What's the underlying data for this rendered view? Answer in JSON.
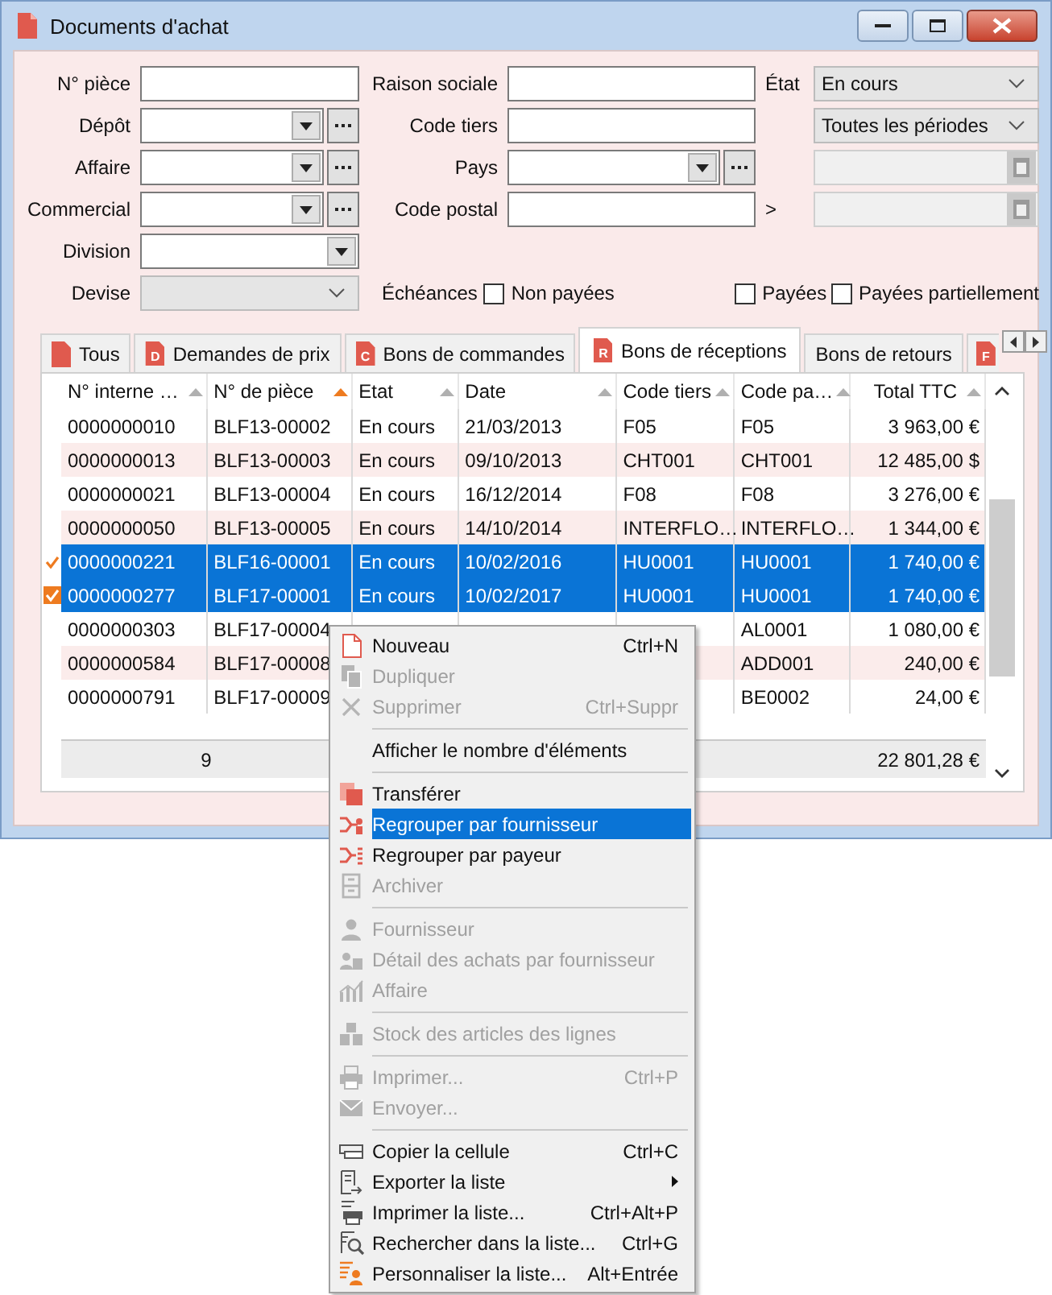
{
  "window": {
    "title": "Documents d'achat"
  },
  "left_fields": [
    {
      "label": "N° pièce",
      "kind": "text"
    },
    {
      "label": "Dépôt",
      "kind": "combo"
    },
    {
      "label": "Affaire",
      "kind": "combo"
    },
    {
      "label": "Commercial",
      "kind": "combo"
    },
    {
      "label": "Division",
      "kind": "dropdown"
    },
    {
      "label": "Devise",
      "kind": "select",
      "disabled": true
    }
  ],
  "middle_fields": [
    {
      "label": "Raison sociale",
      "kind": "text"
    },
    {
      "label": "Code tiers",
      "kind": "text"
    },
    {
      "label": "Pays",
      "kind": "combo"
    },
    {
      "label": "Code postal",
      "kind": "text"
    }
  ],
  "etat": {
    "label": "État",
    "value": "En cours"
  },
  "period": {
    "value": "Toutes les périodes"
  },
  "date_from": {
    "disabled": true
  },
  "date_to": {
    "label": ">",
    "disabled": true
  },
  "echeances": {
    "label": "Échéances",
    "options": [
      {
        "label": "Non payées",
        "checked": false
      },
      {
        "label": "Payées",
        "checked": false
      },
      {
        "label": "Payées partiellement",
        "checked": false
      }
    ]
  },
  "tabs": [
    {
      "label": "Tous",
      "selected": false
    },
    {
      "label": "Demandes de prix",
      "badge": "D",
      "selected": false
    },
    {
      "label": "Bons de commandes",
      "badge": "C",
      "selected": false
    },
    {
      "label": "Bons de réceptions",
      "badge": "R",
      "selected": true
    },
    {
      "label": "Bons de retours",
      "selected": false
    },
    {
      "badge": "F",
      "selected": false
    }
  ],
  "table": {
    "columns": [
      {
        "label": "N° interne …",
        "sorted": false
      },
      {
        "label": "N° de pièce",
        "sorted": true
      },
      {
        "label": "Etat",
        "sorted": false
      },
      {
        "label": "Date",
        "sorted": false
      },
      {
        "label": "Code tiers",
        "sorted": false
      },
      {
        "label": "Code pa…",
        "sorted": false
      },
      {
        "label": "Total TTC",
        "sorted": false
      }
    ],
    "rows": [
      {
        "cells": [
          "0000000010",
          "BLF13-00002",
          "En cours",
          "21/03/2013",
          "F05",
          "F05",
          "3 963,00 €"
        ],
        "selected": false,
        "current": false,
        "checked": false
      },
      {
        "cells": [
          "0000000013",
          "BLF13-00003",
          "En cours",
          "09/10/2013",
          "CHT001",
          "CHT001",
          "12 485,00 $"
        ],
        "selected": false,
        "current": false,
        "checked": false
      },
      {
        "cells": [
          "0000000021",
          "BLF13-00004",
          "En cours",
          "16/12/2014",
          "F08",
          "F08",
          "3 276,00 €"
        ],
        "selected": false,
        "current": false,
        "checked": false
      },
      {
        "cells": [
          "0000000050",
          "BLF13-00005",
          "En cours",
          "14/10/2014",
          "INTERFLO…",
          "INTERFLO…",
          "1 344,00 €"
        ],
        "selected": false,
        "current": false,
        "checked": false
      },
      {
        "cells": [
          "0000000221",
          "BLF16-00001",
          "En cours",
          "10/02/2016",
          "HU0001",
          "HU0001",
          "1 740,00 €"
        ],
        "selected": true,
        "current": true,
        "checked": false
      },
      {
        "cells": [
          "0000000277",
          "BLF17-00001",
          "En cours",
          "10/02/2017",
          "HU0001",
          "HU0001",
          "1 740,00 €"
        ],
        "selected": true,
        "current": false,
        "checked": true
      },
      {
        "cells": [
          "0000000303",
          "BLF17-00004",
          "",
          "",
          "",
          "AL0001",
          "1 080,00 €"
        ],
        "selected": false,
        "current": false,
        "checked": false
      },
      {
        "cells": [
          "0000000584",
          "BLF17-00008",
          "",
          "",
          "",
          "ADD001",
          "240,00 €"
        ],
        "selected": false,
        "current": false,
        "checked": false
      },
      {
        "cells": [
          "0000000791",
          "BLF17-00009",
          "",
          "",
          "",
          "BE0002",
          "24,00 €"
        ],
        "selected": false,
        "current": false,
        "checked": false
      }
    ],
    "footer": {
      "count": "9",
      "total": "22 801,28 €"
    }
  },
  "menu": {
    "groups": [
      {
        "items": [
          {
            "label": "Nouveau",
            "shortcut": "Ctrl+N",
            "disabled": false,
            "selected": false
          },
          {
            "label": "Dupliquer",
            "disabled": true,
            "selected": false
          },
          {
            "label": "Supprimer",
            "shortcut": "Ctrl+Suppr",
            "disabled": true,
            "selected": false
          }
        ]
      },
      {
        "items": [
          {
            "label": "Afficher le nombre d'éléments",
            "disabled": false,
            "selected": false
          }
        ]
      },
      {
        "items": [
          {
            "label": "Transférer",
            "disabled": false,
            "selected": false
          },
          {
            "label": "Regrouper par fournisseur",
            "disabled": false,
            "selected": true
          },
          {
            "label": "Regrouper par payeur",
            "disabled": false,
            "selected": false
          },
          {
            "label": "Archiver",
            "disabled": true,
            "selected": false
          }
        ]
      },
      {
        "items": [
          {
            "label": "Fournisseur",
            "disabled": true,
            "selected": false
          },
          {
            "label": "Détail des achats par fournisseur",
            "disabled": true,
            "selected": false
          },
          {
            "label": "Affaire",
            "disabled": true,
            "selected": false
          }
        ]
      },
      {
        "items": [
          {
            "label": "Stock des articles des lignes",
            "disabled": true,
            "selected": false
          }
        ]
      },
      {
        "items": [
          {
            "label": "Imprimer...",
            "shortcut": "Ctrl+P",
            "disabled": true,
            "selected": false
          },
          {
            "label": "Envoyer...",
            "disabled": true,
            "selected": false
          }
        ]
      },
      {
        "items": [
          {
            "label": "Copier la cellule",
            "shortcut": "Ctrl+C",
            "disabled": false,
            "selected": false
          },
          {
            "label": "Exporter la liste",
            "submenu": true,
            "disabled": false,
            "selected": false
          },
          {
            "label": "Imprimer la liste...",
            "shortcut": "Ctrl+Alt+P",
            "disabled": false,
            "selected": false
          },
          {
            "label": "Rechercher dans la liste...",
            "shortcut": "Ctrl+G",
            "disabled": false,
            "selected": false
          },
          {
            "label": "Personnaliser la liste...",
            "shortcut": "Alt+Entrée",
            "disabled": false,
            "selected": false
          }
        ]
      }
    ]
  }
}
